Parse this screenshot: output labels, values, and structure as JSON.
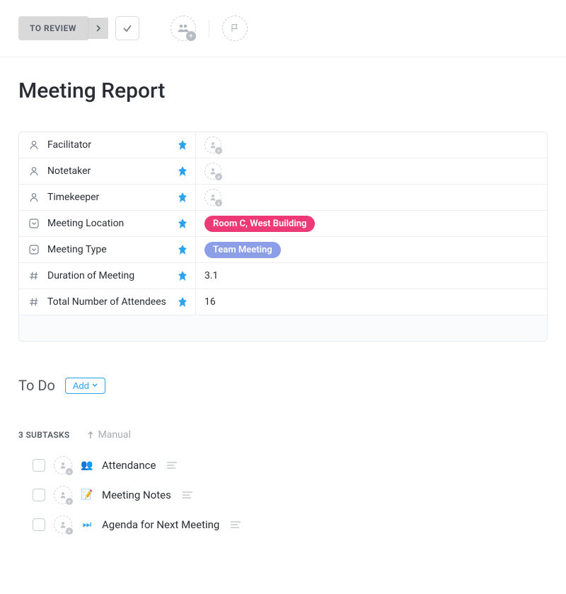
{
  "toolbar": {
    "status_label": "TO REVIEW"
  },
  "page": {
    "title": "Meeting Report"
  },
  "fields": [
    {
      "icon": "person",
      "label": "Facilitator",
      "type": "person"
    },
    {
      "icon": "person",
      "label": "Notetaker",
      "type": "person"
    },
    {
      "icon": "person",
      "label": "Timekeeper",
      "type": "person"
    },
    {
      "icon": "dropdown",
      "label": "Meeting Location",
      "type": "tag-pink",
      "value": "Room C, West Building"
    },
    {
      "icon": "dropdown",
      "label": "Meeting Type",
      "type": "tag-blue",
      "value": "Team Meeting"
    },
    {
      "icon": "number",
      "label": "Duration of Meeting",
      "type": "text",
      "value": "3.1"
    },
    {
      "icon": "number",
      "label": "Total Number of Attendees",
      "type": "text",
      "value": "16"
    }
  ],
  "todo": {
    "title": "To Do",
    "add_label": "Add"
  },
  "subtasks": {
    "count_label": "3 SUBTASKS",
    "sort_label": "Manual",
    "items": [
      {
        "icon": "👥",
        "icon_color": "#ff8c42",
        "name": "Attendance"
      },
      {
        "icon": "📝",
        "icon_color": "#ff6b6b",
        "name": "Meeting Notes"
      },
      {
        "icon": "⏭",
        "icon_color": "#2ba3ef",
        "name": "Agenda for Next Meeting"
      }
    ]
  }
}
